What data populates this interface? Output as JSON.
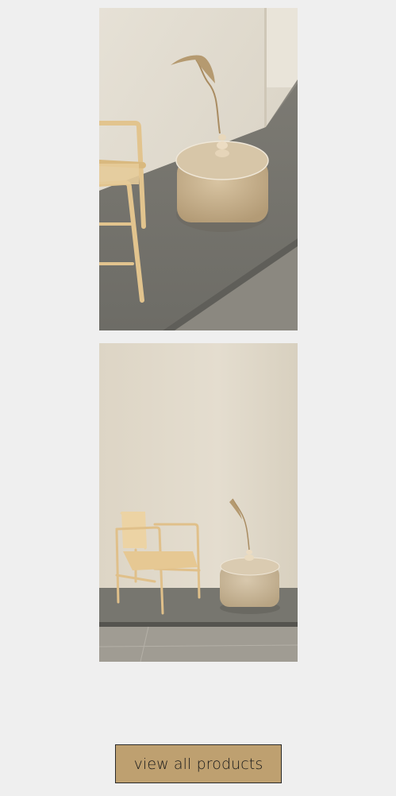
{
  "gallery": {
    "images": [
      {
        "name": "Product lifestyle photo – chair and pouf with dried leaf vase (close-up)"
      },
      {
        "name": "Product lifestyle photo – chair and pouf with dried leaf vase (wide)"
      }
    ]
  },
  "cta": {
    "label": "view all products"
  },
  "colors": {
    "page_background": "#efefef",
    "button_background": "#bea070",
    "button_border": "#2a2a2a",
    "wall": "#e3ddd0",
    "floor_platform": "#7b7a74",
    "wood": "#e2c48e",
    "fabric": "#c8b08a"
  }
}
